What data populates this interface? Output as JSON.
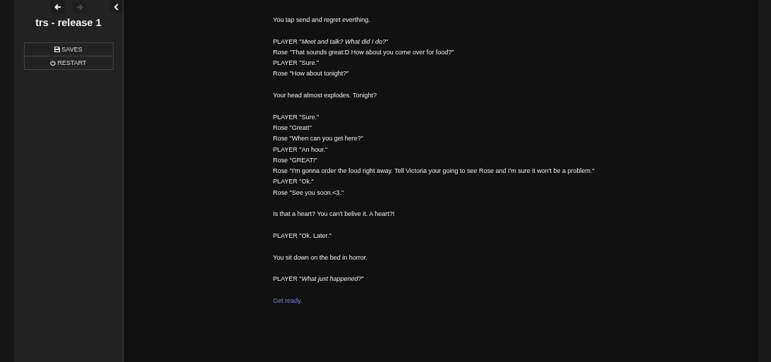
{
  "history": [
    {
      "kind": "back",
      "disabled": false
    },
    {
      "kind": "forward",
      "disabled": true
    }
  ],
  "story_title": "trs - release 1",
  "menu": [
    {
      "kind": "saves",
      "label": "SAVES"
    },
    {
      "kind": "restart",
      "label": "RESTART"
    }
  ],
  "passage": [
    [
      "You tap send and regret everthing."
    ],
    [
      "PLAYER \"*Meet and talk? What did I do?*\"",
      "Rose \"That sounds great:D How about you come over for food?\"",
      "PLAYER \"Sure.\"",
      "Rose \"How about tonight?\""
    ],
    [
      "Your head almost explodes. Tonight?"
    ],
    [
      "PLAYER \"Sure.\"",
      "Rose \"Great!\"",
      "Rose \"When can you get here?\"",
      "PLAYER \"An hour.\"",
      "Rose \"GREAT!\"",
      "Rose \"I'm gonna order the food right away. Tell Victoria your going to see Rose and I'm sure it won't be a problem.\"",
      "PLAYER \"Ok.\"",
      "Rose \"See you soon.<3.\""
    ],
    [
      "Is that a heart? You can't belive it. A heart?!"
    ],
    [
      "PLAYER \"Ok. Later.\""
    ],
    [
      "You sit down on the bed in horror."
    ],
    [
      "PLAYER \"*What just happened?*\""
    ]
  ],
  "link": "Get ready."
}
